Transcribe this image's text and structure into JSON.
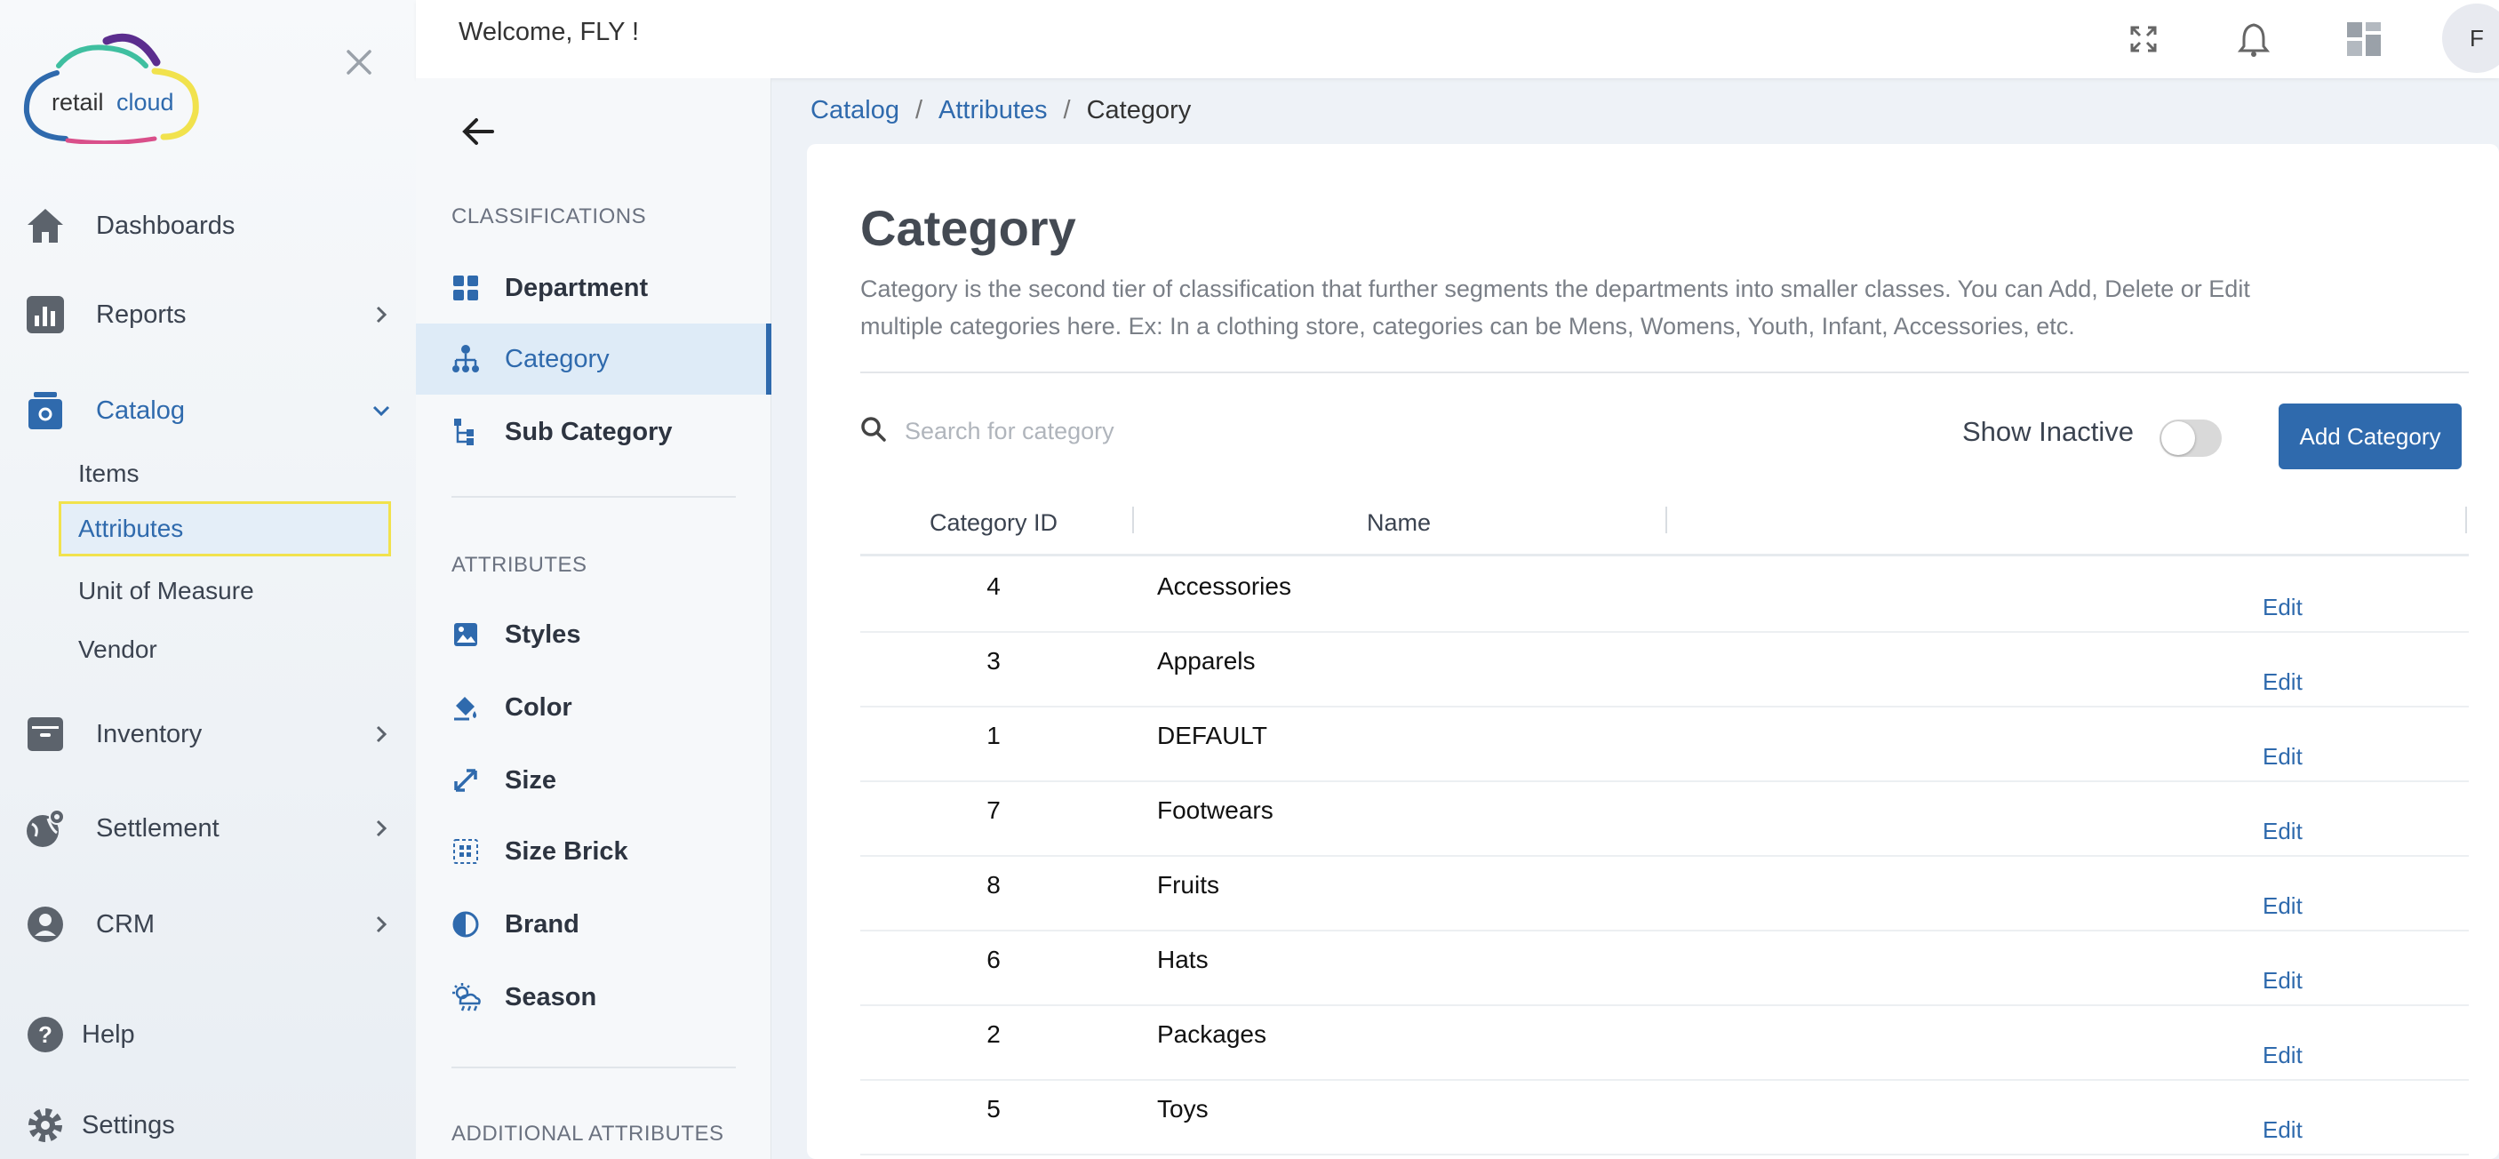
{
  "app": {
    "logo_text_a": "retail",
    "logo_text_b": "cloud",
    "accent": "#2f6aad",
    "highlight": "#f1e24d"
  },
  "topbar": {
    "welcome": "Welcome, FLY !",
    "avatar_initial": "F",
    "icons": [
      "fullscreen-icon",
      "bell-icon",
      "apps-grid-icon"
    ]
  },
  "nav": {
    "items": [
      {
        "label": "Dashboards",
        "icon": "home-icon"
      },
      {
        "label": "Reports",
        "icon": "bar-chart-icon"
      },
      {
        "label": "Catalog",
        "icon": "catalog-icon"
      },
      {
        "label": "Inventory",
        "icon": "archive-icon"
      },
      {
        "label": "Settlement",
        "icon": "globe-pin-icon"
      },
      {
        "label": "CRM",
        "icon": "user-gear-icon"
      },
      {
        "label": "Help",
        "icon": "help-icon"
      },
      {
        "label": "Settings",
        "icon": "gear-icon"
      }
    ],
    "catalog_sub": [
      "Items",
      "Attributes",
      "Unit of Measure",
      "Vendor"
    ]
  },
  "side2": {
    "sec_classifications": "CLASSIFICATIONS",
    "classifications": [
      {
        "label": "Department",
        "icon": "grid-icon"
      },
      {
        "label": "Category",
        "icon": "hierarchy-icon"
      },
      {
        "label": "Sub Category",
        "icon": "subtree-icon"
      }
    ],
    "sec_attributes": "ATTRIBUTES",
    "attributes": [
      {
        "label": "Styles",
        "icon": "image-icon"
      },
      {
        "label": "Color",
        "icon": "paint-bucket-icon"
      },
      {
        "label": "Size",
        "icon": "resize-icon"
      },
      {
        "label": "Size Brick",
        "icon": "brick-grid-icon"
      },
      {
        "label": "Brand",
        "icon": "half-circle-icon"
      },
      {
        "label": "Season",
        "icon": "weather-icon"
      }
    ],
    "sec_additional": "ADDITIONAL ATTRIBUTES"
  },
  "breadcrumb": {
    "level1": "Catalog",
    "sep": "/",
    "level2": "Attributes",
    "current": "Category"
  },
  "main": {
    "title": "Category",
    "description": "Category is the second tier of classification that further segments the departments into smaller classes. You can Add, Delete or Edit multiple categories here. Ex: In a clothing store, categories can be Mens, Womens, Youth, Infant, Accessories, etc.",
    "search_placeholder": "Search for category",
    "show_inactive": "Show Inactive",
    "add_button": "Add Category",
    "columns": [
      "Category ID",
      "Name"
    ],
    "edit_label": "Edit",
    "rows": [
      {
        "id": "4",
        "name": "Accessories"
      },
      {
        "id": "3",
        "name": "Apparels"
      },
      {
        "id": "1",
        "name": "DEFAULT"
      },
      {
        "id": "7",
        "name": "Footwears"
      },
      {
        "id": "8",
        "name": "Fruits"
      },
      {
        "id": "6",
        "name": "Hats"
      },
      {
        "id": "2",
        "name": "Packages"
      },
      {
        "id": "5",
        "name": "Toys"
      }
    ]
  }
}
